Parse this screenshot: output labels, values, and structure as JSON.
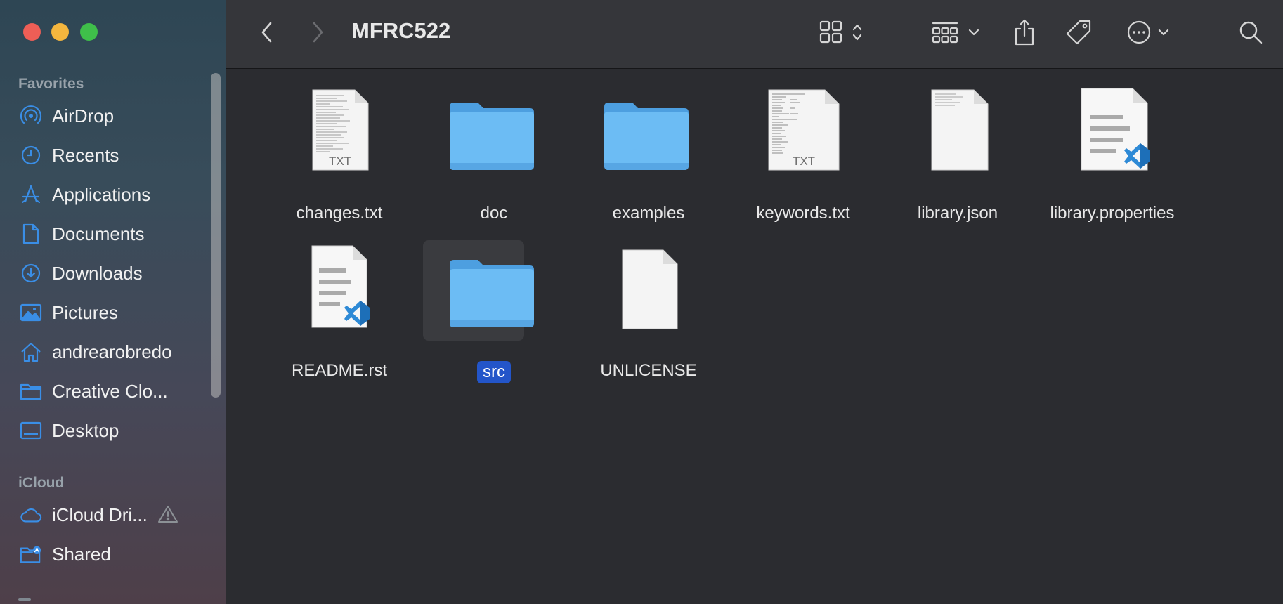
{
  "window": {
    "title": "MFRC522"
  },
  "sidebar": {
    "favorites_heading": "Favorites",
    "items": [
      {
        "label": "AirDrop",
        "icon": "airdrop-icon"
      },
      {
        "label": "Recents",
        "icon": "clock-icon"
      },
      {
        "label": "Applications",
        "icon": "applications-icon"
      },
      {
        "label": "Documents",
        "icon": "document-icon"
      },
      {
        "label": "Downloads",
        "icon": "download-icon"
      },
      {
        "label": "Pictures",
        "icon": "pictures-icon"
      },
      {
        "label": "andrearobredo",
        "icon": "home-icon"
      },
      {
        "label": "Creative Clo...",
        "icon": "folder-icon"
      },
      {
        "label": "Desktop",
        "icon": "desktop-icon"
      }
    ],
    "icloud_heading": "iCloud",
    "icloud_items": [
      {
        "label": "iCloud Dri...",
        "icon": "cloud-icon",
        "warning": true
      },
      {
        "label": "Shared",
        "icon": "shared-folder-icon"
      }
    ]
  },
  "files": [
    {
      "name": "changes.txt",
      "kind": "txt",
      "badge": "TXT"
    },
    {
      "name": "doc",
      "kind": "folder"
    },
    {
      "name": "examples",
      "kind": "folder"
    },
    {
      "name": "keywords.txt",
      "kind": "txt",
      "badge": "TXT"
    },
    {
      "name": "library.json",
      "kind": "blank"
    },
    {
      "name": "library.properties",
      "kind": "vscode"
    },
    {
      "name": "README.rst",
      "kind": "vscode"
    },
    {
      "name": "src",
      "kind": "folder",
      "selected": true
    },
    {
      "name": "UNLICENSE",
      "kind": "blank"
    }
  ],
  "colors": {
    "folder": "#66b7f0",
    "selection": "#2355c9",
    "accent": "#3a8ee6"
  }
}
